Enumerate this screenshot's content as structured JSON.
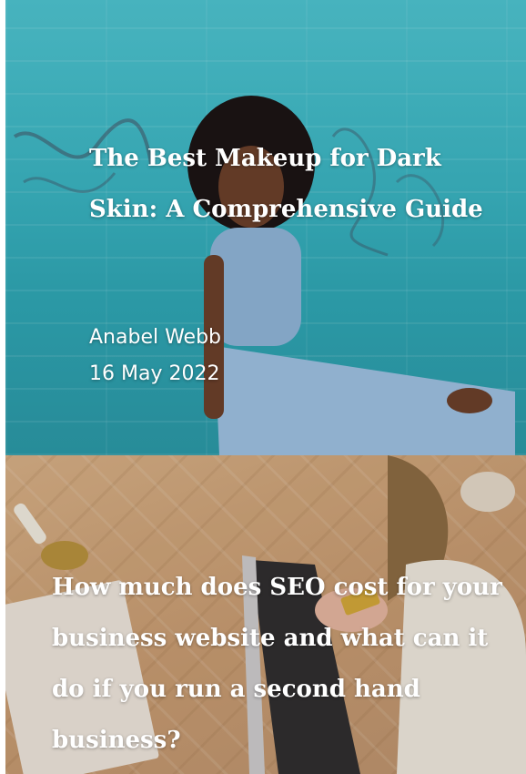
{
  "cards": [
    {
      "title": "The Best Makeup for Dark Skin: A Comprehensive Guide",
      "author": "Anabel Webb",
      "date": "16 May 2022"
    },
    {
      "title": "How much does SEO cost for your business website and what can it do if you run a second hand business?"
    }
  ]
}
